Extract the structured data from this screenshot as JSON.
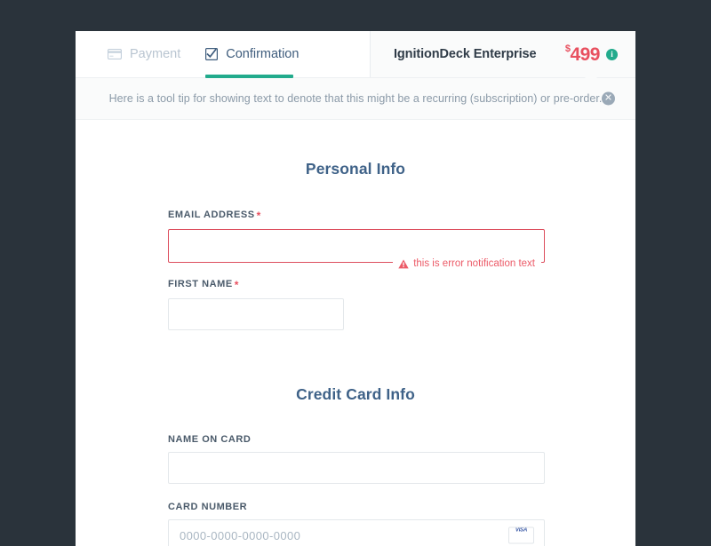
{
  "page": {
    "background_color": "#2a333b",
    "card_background": "#ffffff"
  },
  "header": {
    "tabs": [
      {
        "label": "Payment",
        "icon": "credit-card-icon",
        "active": false,
        "color": "#b9c5d1"
      },
      {
        "label": "Confirmation",
        "icon": "checkbox-checked-icon",
        "active": true,
        "color": "#3f5d7d",
        "underline_color": "#22ab8c"
      }
    ],
    "product_name": "IgnitionDeck Enterprise",
    "price": {
      "currency_symbol": "$",
      "amount": "499",
      "color": "#e8505f"
    },
    "info_icon": {
      "name": "info-circle-icon",
      "glyph": "i",
      "color": "#22ab8c"
    }
  },
  "tooltip": {
    "text": "Here is a tool tip for showing text to denote that this might be a recurring (subscription) or pre-order.",
    "close_icon": "close-circle-icon",
    "close_glyph": "✕",
    "background": "#fafbfb",
    "text_color": "#8b9aa8"
  },
  "sections": [
    {
      "title": "Personal Info",
      "fields": [
        {
          "label": "EMAIL ADDRESS",
          "required": true,
          "required_marker": "*",
          "value": "",
          "placeholder": "",
          "state": "error",
          "error_text": "this is error notification text",
          "error_icon": "warning-triangle-icon",
          "error_color": "#ec5b68"
        },
        {
          "label": "FIRST NAME",
          "required": true,
          "required_marker": "*",
          "value": "",
          "placeholder": "",
          "state": "normal"
        }
      ]
    },
    {
      "title": "Credit Card Info",
      "fields": [
        {
          "label": "NAME ON CARD",
          "required": false,
          "value": "",
          "placeholder": "",
          "state": "normal"
        },
        {
          "label": "CARD NUMBER",
          "required": false,
          "value": "",
          "placeholder": "0000-0000-0000-0000",
          "state": "normal",
          "card_badge": {
            "name": "visa-card-icon",
            "label": "VISA",
            "top_color": "#3b5aa6",
            "bottom_color": "#f4a022"
          }
        }
      ]
    }
  ],
  "theme": {
    "heading_color": "#3f6288",
    "label_color": "#4a5a6a",
    "accent_green": "#22ab8c",
    "accent_red": "#e8505f",
    "border_color": "#e4e8eb"
  }
}
